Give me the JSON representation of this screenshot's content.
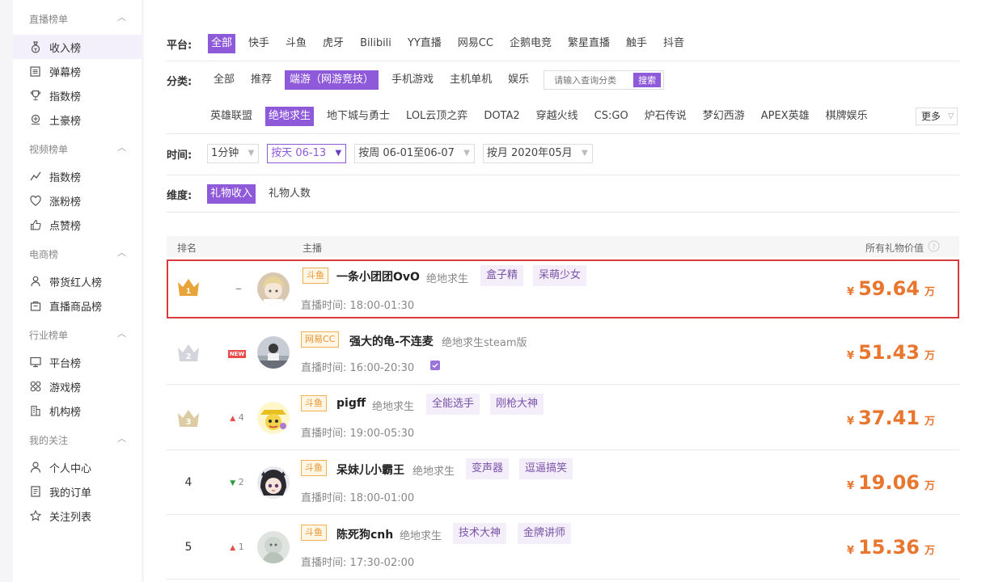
{
  "sidebar": {
    "groups": [
      {
        "title": "直播榜单",
        "items": [
          {
            "label": "收入榜",
            "icon": "money-bag-icon",
            "active": true
          },
          {
            "label": "弹幕榜",
            "icon": "list-icon"
          },
          {
            "label": "指数榜",
            "icon": "trophy-icon"
          },
          {
            "label": "土豪榜",
            "icon": "rich-icon"
          }
        ]
      },
      {
        "title": "视频榜单",
        "items": [
          {
            "label": "指数榜",
            "icon": "trend-icon"
          },
          {
            "label": "涨粉榜",
            "icon": "heart-icon"
          },
          {
            "label": "点赞榜",
            "icon": "thumbs-up-icon"
          }
        ]
      },
      {
        "title": "电商榜",
        "items": [
          {
            "label": "带货红人榜",
            "icon": "person-icon"
          },
          {
            "label": "直播商品榜",
            "icon": "bag-icon"
          }
        ]
      },
      {
        "title": "行业榜单",
        "items": [
          {
            "label": "平台榜",
            "icon": "monitor-icon"
          },
          {
            "label": "游戏榜",
            "icon": "grid-icon"
          },
          {
            "label": "机构榜",
            "icon": "building-icon"
          }
        ]
      },
      {
        "title": "我的关注",
        "items": [
          {
            "label": "个人中心",
            "icon": "user-icon"
          },
          {
            "label": "我的订单",
            "icon": "document-icon"
          },
          {
            "label": "关注列表",
            "icon": "star-icon"
          }
        ]
      }
    ]
  },
  "filters": {
    "platform_label": "平台:",
    "platforms": [
      "全部",
      "快手",
      "斗鱼",
      "虎牙",
      "Bilibili",
      "YY直播",
      "网易CC",
      "企鹅电竞",
      "繁星直播",
      "触手",
      "抖音"
    ],
    "category_label": "分类:",
    "categories": [
      "全部",
      "推荐",
      "端游（网游竞技）",
      "手机游戏",
      "主机单机",
      "娱乐"
    ],
    "search_placeholder": "请输入查询分类",
    "search_button": "搜索",
    "subcategories": [
      "英雄联盟",
      "绝地求生",
      "地下城与勇士",
      "LOL云顶之弈",
      "DOTA2",
      "穿越火线",
      "CS:GO",
      "炉石传说",
      "梦幻西游",
      "APEX英雄",
      "棋牌娱乐"
    ],
    "more_label": "更多",
    "time_label": "时间:",
    "time_options": [
      "1分钟",
      "按天 06-13",
      "按周 06-01至06-07",
      "按月 2020年05月"
    ],
    "dimension_label": "维度:",
    "dimensions": [
      "礼物收入",
      "礼物人数"
    ]
  },
  "table": {
    "headers": {
      "rank": "排名",
      "anchor": "主播",
      "value": "所有礼物价值"
    },
    "time_prefix": "直播时间:",
    "currency": "¥",
    "unit": "万",
    "rows": [
      {
        "rank": "1",
        "trend": "–",
        "platform": "斗鱼",
        "name": "一条小团团OvO",
        "category": "绝地求生",
        "tags": [
          "盒子精",
          "呆萌少女"
        ],
        "time": "18:00-01:30",
        "value": "59.64"
      },
      {
        "rank": "2",
        "trend": "NEW",
        "platform": "网易CC",
        "name": "强大的龟-不连麦",
        "category": "绝地求生steam版",
        "tags": [],
        "time": "16:00-20:30",
        "value": "51.43"
      },
      {
        "rank": "3",
        "trend": "▲ 4",
        "platform": "斗鱼",
        "name": "pigff",
        "category": "绝地求生",
        "tags": [
          "全能选手",
          "刚枪大神"
        ],
        "time": "19:00-05:30",
        "value": "37.41"
      },
      {
        "rank": "4",
        "trend": "▼ 2",
        "platform": "斗鱼",
        "name": "呆妹儿小霸王",
        "category": "绝地求生",
        "tags": [
          "变声器",
          "逗逼搞笑"
        ],
        "time": "18:00-01:00",
        "value": "19.06"
      },
      {
        "rank": "5",
        "trend": "▲ 1",
        "platform": "斗鱼",
        "name": "陈死狗cnh",
        "category": "绝地求生",
        "tags": [
          "技术大神",
          "金牌讲师"
        ],
        "time": "17:30-02:00",
        "value": "15.36"
      }
    ]
  },
  "colors": {
    "accent": "#8f5ad9",
    "price": "#e8762e",
    "highlight_border": "#d93a3a",
    "gold": "#e8a33a",
    "silver": "#c8c8d0",
    "bronze": "#d8c49a"
  }
}
